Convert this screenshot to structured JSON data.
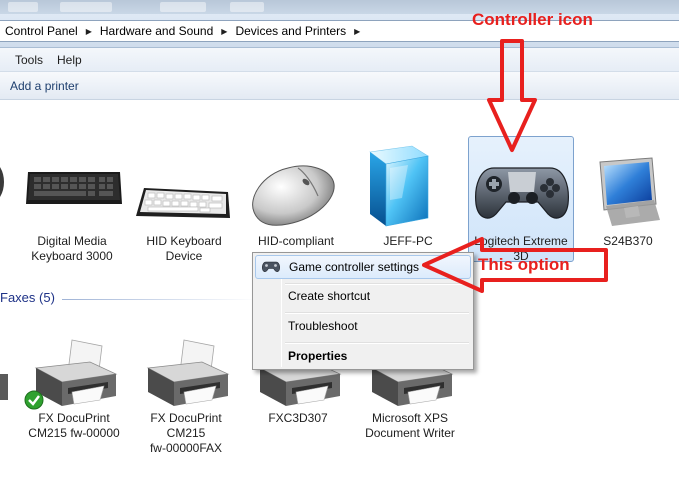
{
  "breadcrumb": {
    "items": [
      "Control Panel",
      "Hardware and Sound",
      "Devices and Printers"
    ],
    "separator_icon": "chevron-right-icon"
  },
  "menu": {
    "items": [
      "Tools",
      "Help"
    ]
  },
  "command_bar": {
    "add_printer": "Add a printer"
  },
  "devices": [
    {
      "name": "Digital Media Keyboard 3000",
      "line1": "Digital Media",
      "line2": "Keyboard 3000",
      "icon": "keyboard-icon"
    },
    {
      "name": "HID Keyboard Device",
      "line1": "HID Keyboard",
      "line2": "Device",
      "icon": "keyboard-icon"
    },
    {
      "name": "HID-compliant",
      "line1": "HID-compliant",
      "line2": "",
      "icon": "mouse-icon"
    },
    {
      "name": "JEFF-PC",
      "line1": "JEFF-PC",
      "line2": "",
      "icon": "computer-cube-icon"
    },
    {
      "name": "Logitech Extreme 3D",
      "line1": "Logitech Extreme",
      "line2": "3D",
      "icon": "gamepad-icon",
      "selected": true
    },
    {
      "name": "S24B370",
      "line1": "S24B370",
      "line2": "",
      "icon": "monitor-icon"
    }
  ],
  "printers_section": {
    "header": "Faxes (5)"
  },
  "printers": [
    {
      "line1": "FX DocuPrint",
      "line2": "CM215 fw-00000",
      "line3": "",
      "icon": "printer-icon",
      "default": true
    },
    {
      "line1": "FX DocuPrint",
      "line2": "CM215",
      "line3": "fw-00000FAX",
      "icon": "printer-icon"
    },
    {
      "line1": "FXC3D307",
      "line2": "",
      "line3": "",
      "icon": "printer-icon"
    },
    {
      "line1": "Microsoft XPS",
      "line2": "Document Writer",
      "line3": "",
      "icon": "printer-icon"
    }
  ],
  "context_menu": {
    "items": [
      {
        "label": "Game controller settings",
        "highlighted": true,
        "icon": "gamepad-icon"
      },
      {
        "label": "Create shortcut"
      },
      {
        "label": "Troubleshoot"
      },
      {
        "label": "Properties",
        "bold": true
      }
    ]
  },
  "annotations": {
    "top": "Controller icon",
    "right": "This option",
    "color": "#e8201e"
  },
  "colors": {
    "accent": "#1e3287",
    "selection": "#cfe4fa"
  }
}
